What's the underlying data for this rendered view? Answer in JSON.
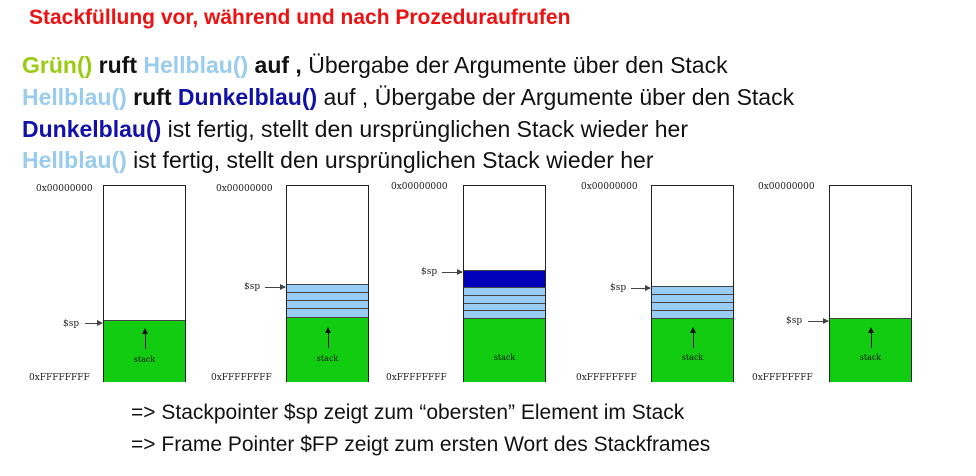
{
  "title": "Stackfüllung vor, während und nach Prozeduraufrufen",
  "lines": [
    {
      "caller": "Grün()",
      "ruft": "ruft",
      "callee": "Hellblau()",
      "auf": "auf ,",
      "rest": " Übergabe der Argumente über den Stack"
    },
    {
      "caller": "Hellblau()",
      "ruft": "ruft",
      "callee": "Dunkelblau()",
      "rest": " auf , Übergabe der Argumente über den Stack"
    },
    {
      "callee": "Dunkelblau()",
      "rest": " ist fertig, stellt den ursprünglichen Stack wieder her"
    },
    {
      "callee": "Hellblau()",
      "rest": " ist fertig, stellt den ursprünglichen Stack wieder her"
    }
  ],
  "diagram": {
    "top_address": "0x00000000",
    "bottom_address": "0xFFFFFFFF",
    "sp_label": "$sp",
    "stack_label": "stack",
    "colors": {
      "green": "#11cc11",
      "light_blue": "#99ccf5",
      "dark_blue": "#0000bb"
    }
  },
  "notes": [
    "=> Stackpointer $sp zeigt zum “obersten” Element im Stack",
    "=> Frame Pointer $FP zeigt zum ersten Wort des Stackframes"
  ]
}
